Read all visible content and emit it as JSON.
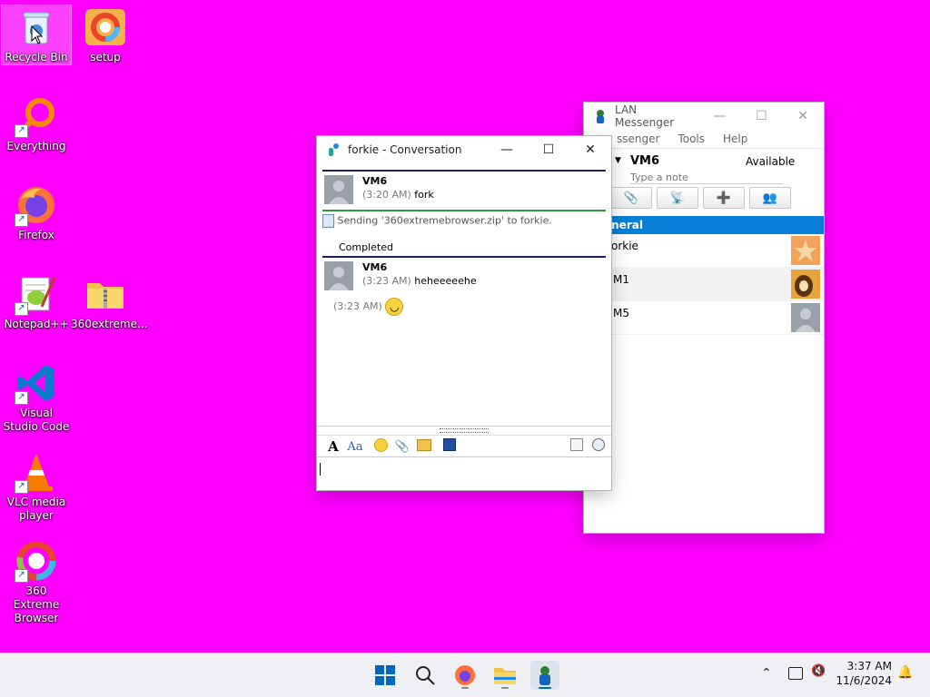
{
  "desktop": {
    "icons": [
      {
        "label": "Recycle Bin",
        "icon": "recycle-bin-icon"
      },
      {
        "label": "setup",
        "icon": "setup-360-icon"
      },
      {
        "label": "Everything",
        "icon": "everything-search-icon"
      },
      {
        "label": "Firefox",
        "icon": "firefox-icon"
      },
      {
        "label": "Notepad++",
        "icon": "notepadpp-icon"
      },
      {
        "label": "360extreme...",
        "icon": "zip-folder-icon"
      },
      {
        "label": "Visual Studio Code",
        "icon": "vscode-icon"
      },
      {
        "label": "VLC media player",
        "icon": "vlc-icon"
      },
      {
        "label": "360 Extreme Browser",
        "icon": "360-browser-icon"
      }
    ]
  },
  "lan": {
    "title": "LAN Messenger",
    "menu": [
      "ssenger",
      "Tools",
      "Help"
    ],
    "user_name": "VM6",
    "status": "Available",
    "note_placeholder": "Type a note",
    "group_name": "eneral",
    "users": [
      {
        "name": "orkie"
      },
      {
        "name": "M1"
      },
      {
        "name": "M5"
      }
    ]
  },
  "conversation": {
    "title": "forkie - Conversation",
    "messages": [
      {
        "sender": "VM6",
        "time": "(3:20 AM)",
        "text": "fork"
      },
      {
        "sender": "VM6",
        "time": "(3:23 AM)",
        "text": "heheeeeehe"
      }
    ],
    "file_transfer": "Sending '360extremebrowser.zip' to forkie.",
    "transfer_status": "Completed",
    "emoji_time": "(3:23 AM)",
    "input_value": ""
  },
  "taskbar": {
    "time": "3:37 AM",
    "date": "11/6/2024",
    "apps": [
      "start-icon",
      "search-icon",
      "firefox-icon",
      "file-explorer-icon",
      "lan-messenger-icon"
    ]
  },
  "colors": {
    "desktop": "#ff00ff",
    "accent": "#0a7fd8",
    "header_line": "#1b1f6e",
    "transfer_line": "#2a9a3a"
  }
}
